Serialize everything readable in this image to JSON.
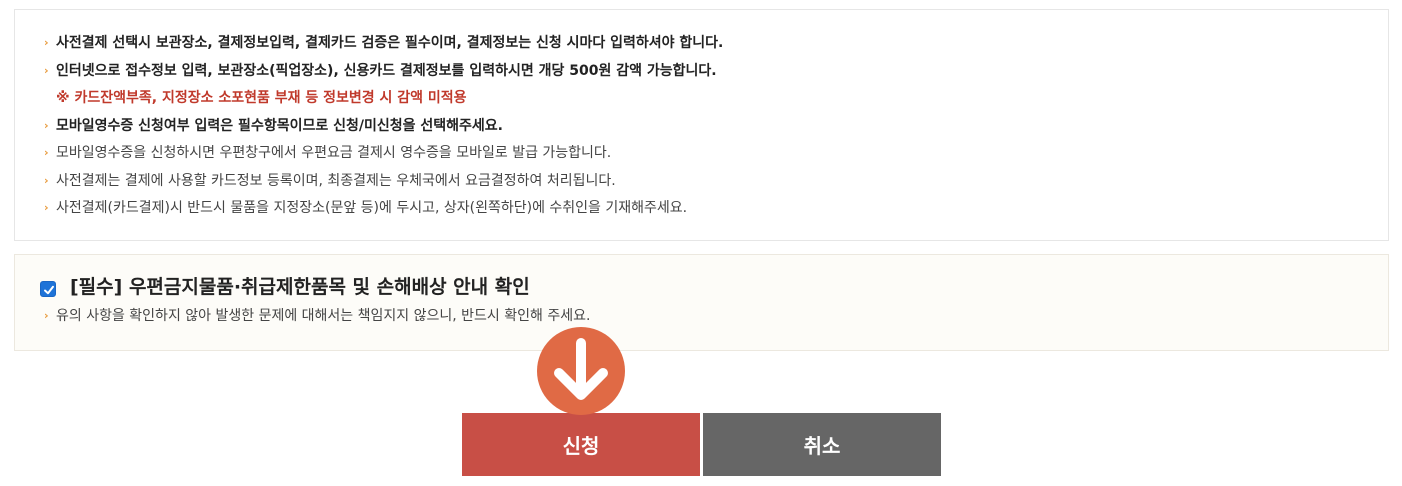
{
  "notice": {
    "lines": [
      {
        "text": "사전결제 선택시 보관장소, 결제정보입력, 결제카드 검증은 필수이며, 결제정보는 신청 시마다 입력하셔야 합니다.",
        "style": "bold"
      },
      {
        "text": "인터넷으로 접수정보 입력, 보관장소(픽업장소), 신용카드 결제정보를 입력하시면 개당 500원 감액 가능합니다.",
        "style": "bold"
      },
      {
        "text": "※ 카드잔액부족, 지정장소 소포현품 부재 등 정보변경 시 감액 미적용",
        "style": "warn"
      },
      {
        "text": "모바일영수증 신청여부 입력은 필수항목이므로 신청/미신청을 선택해주세요.",
        "style": "bold"
      },
      {
        "text": "모바일영수증을 신청하시면 우편창구에서 우편요금 결제시 영수증을 모바일로 발급 가능합니다.",
        "style": "normal"
      },
      {
        "text": "사전결제는 결제에 사용할 카드정보 등록이며, 최종결제는 우체국에서 요금결정하여 처리됩니다.",
        "style": "normal"
      },
      {
        "text": "사전결제(카드결제)시 반드시 물품을 지정장소(문앞 등)에 두시고, 상자(왼쪽하단)에 수취인을 기재해주세요.",
        "style": "normal"
      }
    ],
    "bullet": "›"
  },
  "confirm": {
    "checked": true,
    "title": "[필수] 우편금지물품·취급제한품목 및 손해배상 안내 확인",
    "desc": "유의 사항을 확인하지 않아 발생한 문제에 대해서는 책임지지 않으니, 반드시 확인해 주세요.",
    "bullet": "›"
  },
  "buttons": {
    "apply_label": "신청",
    "cancel_label": "취소"
  },
  "colors": {
    "accent": "#c84f46",
    "arrow_circle": "#e06a45",
    "cancel": "#666666",
    "warn_text": "#c0392b",
    "bullet": "#e89b3d",
    "checkbox": "#1e73d8"
  },
  "icons": {
    "bullet": "chevron-right-icon",
    "arrow": "arrow-down-icon",
    "check": "checkmark-icon"
  }
}
